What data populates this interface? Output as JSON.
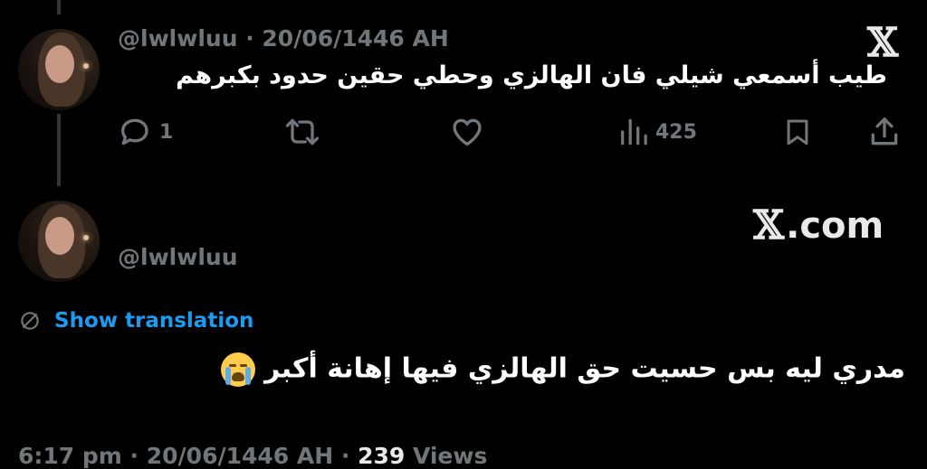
{
  "tweet1": {
    "meta": "@lwlwluu · 20/06/1446 AH",
    "text": "طيب أسمعي شيلي فان الهالزي وحطي حقين حدود بكبرهم",
    "actions": {
      "reply_count": "1",
      "retweet_count": "",
      "like_count": "",
      "views_count": "425"
    }
  },
  "brand": {
    "x_logo": "𝕏",
    "watermark_mark": "𝕏",
    "watermark_text": ".com"
  },
  "tweet2": {
    "handle": "@lwlwluu",
    "translation_label": "Show translation",
    "text": "مدري ليه بس حسيت حق الهالزي فيها إهانة أكبر",
    "emoji_name": "loudly-crying-face",
    "footer": {
      "time": "6:17 pm",
      "sep1": " · ",
      "date": "20/06/1446 AH",
      "sep2": " · ",
      "views_count": "239",
      "views_label": " Views"
    }
  },
  "colors": {
    "background": "#000000",
    "text": "#e7e9ea",
    "muted": "#71767b",
    "link": "#1d9bf0"
  }
}
